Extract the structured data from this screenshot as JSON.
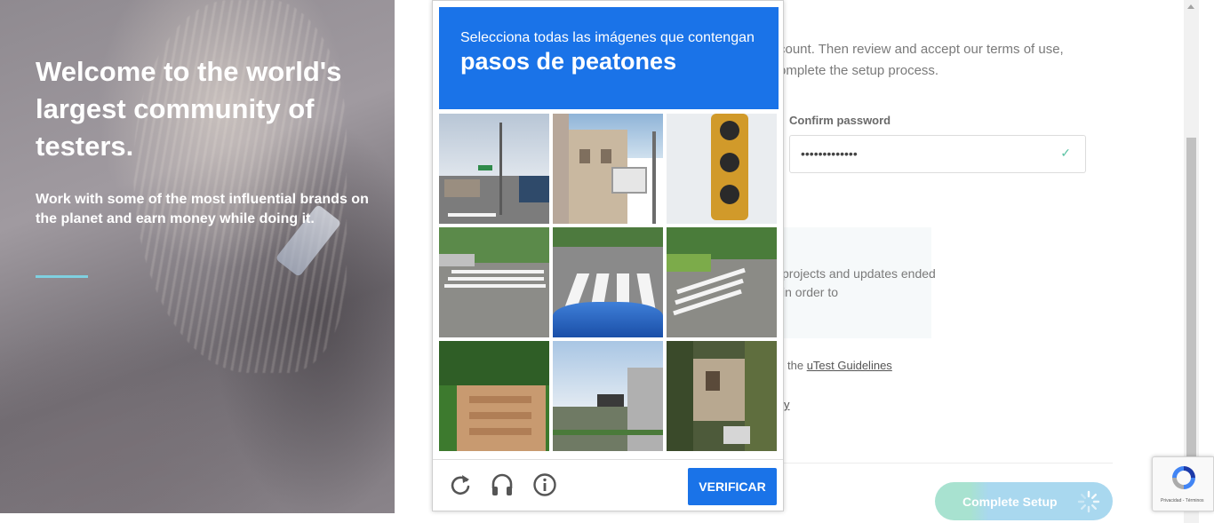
{
  "hero": {
    "title": "Welcome to the world's largest community of testers.",
    "subtitle": "Work with some of the most influential brands on the planet and earn money while doing it."
  },
  "form": {
    "intro_fragment": "count. Then review and accept our terms of use, omplete the setup process.",
    "confirm_password_label": "Confirm password",
    "confirm_password_value": "•••••••••••••",
    "notice_fragment": "projects and updates ended in order to",
    "guidelines_prefix": "the ",
    "guidelines_link": "uTest Guidelines",
    "link_fragment": "y",
    "complete_button_label": "Complete Setup"
  },
  "captcha": {
    "instruction": "Selecciona todas las imágenes que contengan",
    "target": "pasos de peatones",
    "tiles": [
      "street-corner-traffic-light",
      "building-facade-streetlight",
      "traffic-light-closeup",
      "crosswalk-intersection",
      "crosswalk-car-hood",
      "crosswalk-park",
      "concrete-stairs",
      "highway-overpass",
      "garden-house"
    ],
    "verify_label": "VERIFICAR",
    "icons": [
      "reload-icon",
      "audio-icon",
      "info-icon"
    ]
  },
  "recaptcha_badge": {
    "legal": "Privacidad - Términos"
  },
  "colors": {
    "captcha_blue": "#1a73e8",
    "hero_rule": "#7fd0e0",
    "button_gradient_start": "#a8e2d0",
    "button_gradient_end": "#a9d8ef"
  }
}
